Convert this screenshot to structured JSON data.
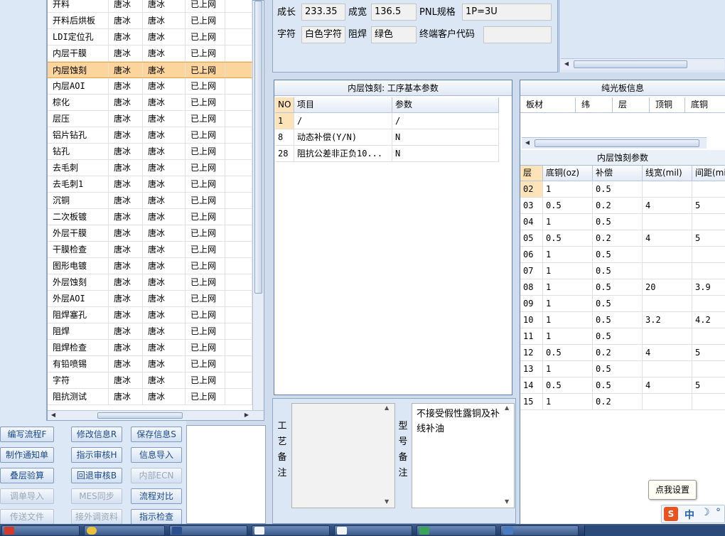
{
  "process_list": {
    "rows": [
      {
        "name": "开料",
        "c1": "唐冰",
        "c2": "唐冰",
        "status": "已上网"
      },
      {
        "name": "开料后烘板",
        "c1": "唐冰",
        "c2": "唐冰",
        "status": "已上网"
      },
      {
        "name": "LDI定位孔",
        "c1": "唐冰",
        "c2": "唐冰",
        "status": "已上网"
      },
      {
        "name": "内层干膜",
        "c1": "唐冰",
        "c2": "唐冰",
        "status": "已上网"
      },
      {
        "name": "内层蚀刻",
        "c1": "唐冰",
        "c2": "唐冰",
        "status": "已上网",
        "selected": true
      },
      {
        "name": "内层AOI",
        "c1": "唐冰",
        "c2": "唐冰",
        "status": "已上网"
      },
      {
        "name": "棕化",
        "c1": "唐冰",
        "c2": "唐冰",
        "status": "已上网"
      },
      {
        "name": "层压",
        "c1": "唐冰",
        "c2": "唐冰",
        "status": "已上网"
      },
      {
        "name": "铝片钻孔",
        "c1": "唐冰",
        "c2": "唐冰",
        "status": "已上网"
      },
      {
        "name": "钻孔",
        "c1": "唐冰",
        "c2": "唐冰",
        "status": "已上网"
      },
      {
        "name": "去毛刺",
        "c1": "唐冰",
        "c2": "唐冰",
        "status": "已上网"
      },
      {
        "name": "去毛刺1",
        "c1": "唐冰",
        "c2": "唐冰",
        "status": "已上网"
      },
      {
        "name": "沉铜",
        "c1": "唐冰",
        "c2": "唐冰",
        "status": "已上网"
      },
      {
        "name": "二次板镀",
        "c1": "唐冰",
        "c2": "唐冰",
        "status": "已上网"
      },
      {
        "name": "外层干膜",
        "c1": "唐冰",
        "c2": "唐冰",
        "status": "已上网"
      },
      {
        "name": "干膜检查",
        "c1": "唐冰",
        "c2": "唐冰",
        "status": "已上网"
      },
      {
        "name": "图形电镀",
        "c1": "唐冰",
        "c2": "唐冰",
        "status": "已上网"
      },
      {
        "name": "外层蚀刻",
        "c1": "唐冰",
        "c2": "唐冰",
        "status": "已上网"
      },
      {
        "name": "外层AOI",
        "c1": "唐冰",
        "c2": "唐冰",
        "status": "已上网"
      },
      {
        "name": "阻焊塞孔",
        "c1": "唐冰",
        "c2": "唐冰",
        "status": "已上网"
      },
      {
        "name": "阻焊",
        "c1": "唐冰",
        "c2": "唐冰",
        "status": "已上网"
      },
      {
        "name": "阻焊检查",
        "c1": "唐冰",
        "c2": "唐冰",
        "status": "已上网"
      },
      {
        "name": "有铅喷锡",
        "c1": "唐冰",
        "c2": "唐冰",
        "status": "已上网"
      },
      {
        "name": "字符",
        "c1": "唐冰",
        "c2": "唐冰",
        "status": "已上网"
      },
      {
        "name": "阻抗测试",
        "c1": "唐冰",
        "c2": "唐冰",
        "status": "已上网"
      }
    ]
  },
  "buttons": [
    {
      "label": "编写流程F",
      "enabled": true
    },
    {
      "label": "修改信息R",
      "enabled": true
    },
    {
      "label": "保存信息S",
      "enabled": true
    },
    {
      "label": "制作通知单",
      "enabled": true
    },
    {
      "label": "指示审核H",
      "enabled": true
    },
    {
      "label": "信息导入",
      "enabled": true
    },
    {
      "label": "叠层验算",
      "enabled": true
    },
    {
      "label": "回退审核B",
      "enabled": true
    },
    {
      "label": "内部ECN",
      "enabled": false
    },
    {
      "label": "调单导入",
      "enabled": false
    },
    {
      "label": "MES同步",
      "enabled": false
    },
    {
      "label": "流程对比",
      "enabled": true
    },
    {
      "label": "传送文件",
      "enabled": false
    },
    {
      "label": "接外调资料",
      "enabled": false
    },
    {
      "label": "指示检查",
      "enabled": true
    }
  ],
  "top_fields": {
    "length_label": "成长",
    "length_value": "233.35",
    "width_label": "成宽",
    "width_value": "136.5",
    "pnl_label": "PNL规格",
    "pnl_value": "1P=3U",
    "char_label": "字符",
    "char_value": "白色字符",
    "mask_label": "阻焊",
    "mask_value": "绿色",
    "customer_label": "终端客户代码",
    "customer_value": ""
  },
  "etch_basic": {
    "title": "内层蚀刻: 工序基本参数",
    "headers": {
      "no": "NO",
      "item": "项目",
      "param": "参数"
    },
    "rows": [
      {
        "no": "1",
        "item": "/",
        "param": "/"
      },
      {
        "no": "8",
        "item": "动态补偿(Y/N)",
        "param": "N"
      },
      {
        "no": "28",
        "item": "阻抗公差非正负10...",
        "param": "N"
      }
    ]
  },
  "remarks": {
    "process_label": "工艺备注",
    "process_text": "",
    "model_label": "型号备注",
    "model_text": "不接受假性露铜及补线补油"
  },
  "plain_board": {
    "title": "纯光板信息",
    "headers": [
      "板材",
      "纬",
      "层",
      "顶铜",
      "底铜"
    ]
  },
  "etch_params": {
    "title": "内层蚀刻参数",
    "headers": {
      "layer": "层",
      "cu": "底铜(oz)",
      "comp": "补偿",
      "line": "线宽(mil)",
      "space": "间距(mil)"
    },
    "rows": [
      {
        "layer": "02",
        "cu": "1",
        "comp": "0.5",
        "line": "",
        "space": ""
      },
      {
        "layer": "03",
        "cu": "0.5",
        "comp": "0.2",
        "line": "4",
        "space": "5"
      },
      {
        "layer": "04",
        "cu": "1",
        "comp": "0.5",
        "line": "",
        "space": ""
      },
      {
        "layer": "05",
        "cu": "0.5",
        "comp": "0.2",
        "line": "4",
        "space": "5"
      },
      {
        "layer": "06",
        "cu": "1",
        "comp": "0.5",
        "line": "",
        "space": ""
      },
      {
        "layer": "07",
        "cu": "1",
        "comp": "0.5",
        "line": "",
        "space": ""
      },
      {
        "layer": "08",
        "cu": "1",
        "comp": "0.5",
        "line": "20",
        "space": "3.9"
      },
      {
        "layer": "09",
        "cu": "1",
        "comp": "0.5",
        "line": "",
        "space": ""
      },
      {
        "layer": "10",
        "cu": "1",
        "comp": "0.5",
        "line": "3.2",
        "space": "4.2"
      },
      {
        "layer": "11",
        "cu": "1",
        "comp": "0.5",
        "line": "",
        "space": ""
      },
      {
        "layer": "12",
        "cu": "0.5",
        "comp": "0.2",
        "line": "4",
        "space": "5"
      },
      {
        "layer": "13",
        "cu": "1",
        "comp": "0.5",
        "line": "",
        "space": ""
      },
      {
        "layer": "14",
        "cu": "0.5",
        "comp": "0.5",
        "line": "4",
        "space": "5"
      },
      {
        "layer": "15",
        "cu": "1",
        "comp": "0.2",
        "line": "",
        "space": ""
      }
    ]
  },
  "tooltip": "点我设置",
  "ime": {
    "logo": "S",
    "mode": "中"
  },
  "colors": {
    "selected_row": "#fbd59c",
    "accent_blue": "#1a4a8c",
    "ime_logo": "#e8531f"
  }
}
